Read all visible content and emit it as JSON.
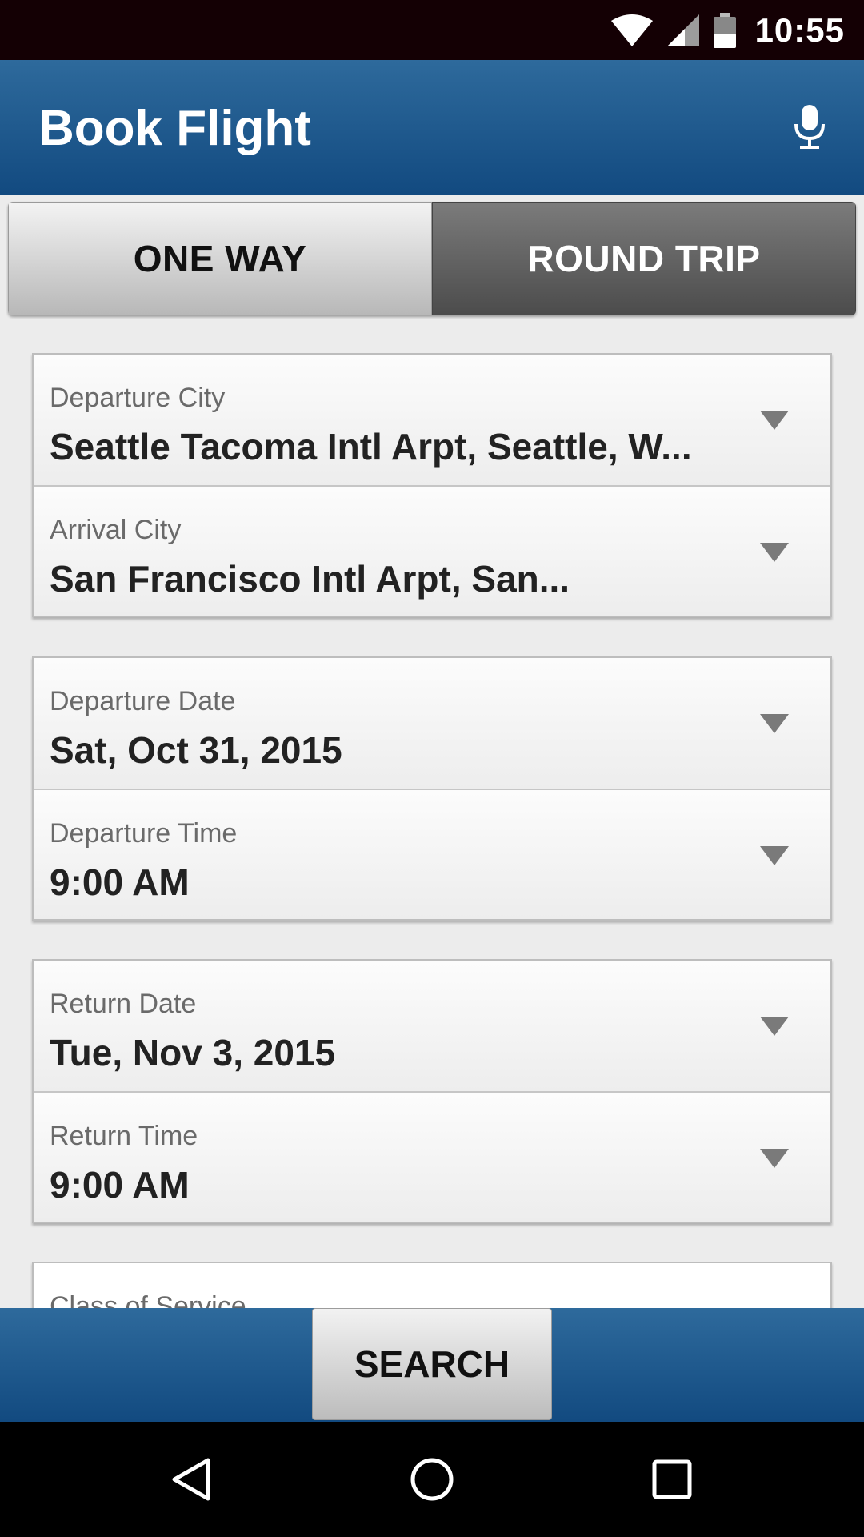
{
  "status_bar": {
    "time": "10:55",
    "icons": [
      "wifi-icon",
      "cell-signal-icon",
      "battery-icon"
    ]
  },
  "app_bar": {
    "title": "Book Flight",
    "mic_icon": "microphone-icon"
  },
  "trip_type": {
    "options": [
      "ONE WAY",
      "ROUND TRIP"
    ],
    "selected": "ROUND TRIP"
  },
  "route": {
    "departure_city": {
      "label": "Departure City",
      "value": "Seattle Tacoma Intl Arpt, Seattle, W..."
    },
    "arrival_city": {
      "label": "Arrival City",
      "value": "San Francisco Intl Arpt, San..."
    }
  },
  "departure": {
    "date": {
      "label": "Departure Date",
      "value": "Sat, Oct 31, 2015"
    },
    "time": {
      "label": "Departure Time",
      "value": "9:00 AM"
    }
  },
  "return": {
    "date": {
      "label": "Return Date",
      "value": "Tue, Nov 3, 2015"
    },
    "time": {
      "label": "Return Time",
      "value": "9:00 AM"
    }
  },
  "class_of_service": {
    "label": "Class of Service"
  },
  "actions": {
    "search_label": "SEARCH"
  },
  "nav": [
    "back-icon",
    "home-icon",
    "recents-icon"
  ],
  "colors": {
    "app_bar": "#1f5a8e",
    "status_bar": "#140004",
    "selected_segment": "#5e5e5e"
  }
}
